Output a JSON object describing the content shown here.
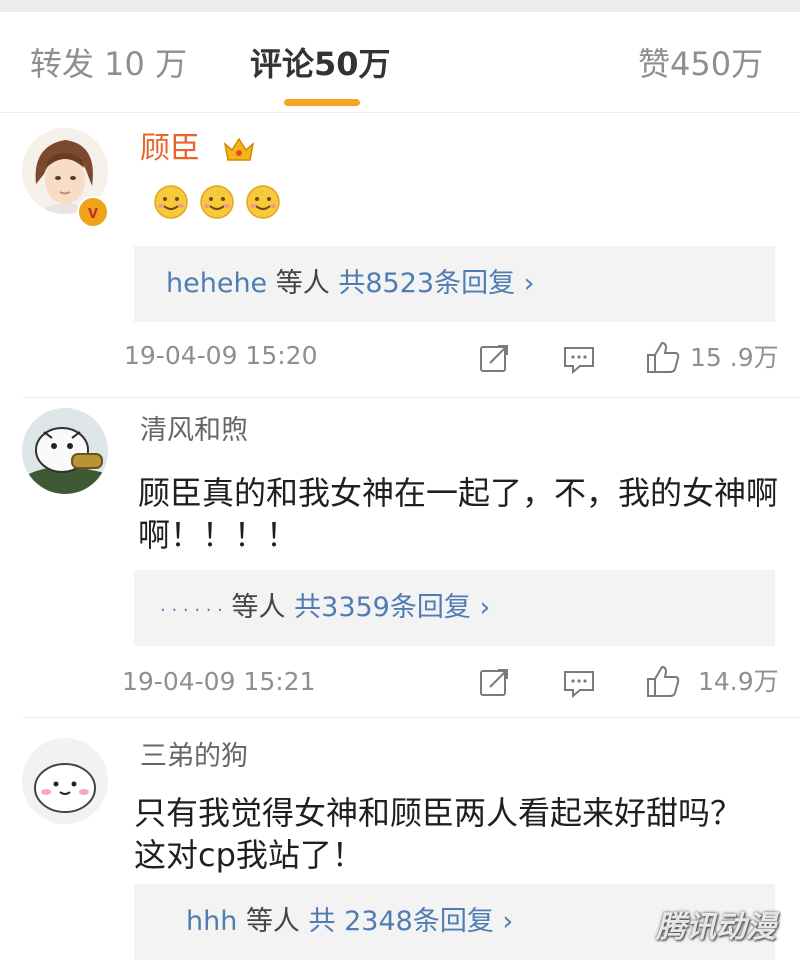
{
  "tabs": {
    "forward_label": "转发 10 万",
    "comments_label": "评论50万",
    "likes_label": "赞450万",
    "accent_color": "#f7a526"
  },
  "comments": [
    {
      "username": "顾臣",
      "username_color": "#e8652a",
      "badges": [
        "crown-icon",
        "verified-v-icon"
      ],
      "emojis": [
        "smile-emoji",
        "smile-emoji",
        "smile-emoji"
      ],
      "reply_users": "hehehe",
      "reply_sep": "等人",
      "reply_total": "共8523条回复",
      "reply_chevron": "›",
      "time": "19-04-09 15:20",
      "likes": "15 .9万"
    },
    {
      "username": "清风和煦",
      "username_color": "#666666",
      "text": "顾臣真的和我女神在一起了，不，我的女神啊啊！！！！",
      "reply_users": "· · · · · ·",
      "reply_sep": "等人",
      "reply_total": "共3359条回复",
      "reply_chevron": "›",
      "time": "19-04-09 15:21",
      "likes": "14.9万"
    },
    {
      "username": "三弟的狗",
      "username_color": "#666666",
      "text": "只有我觉得女神和顾臣两人看起来好甜吗？这对cp我站了！",
      "reply_users": "hhh",
      "reply_sep": "等人",
      "reply_total": "共 2348条回复",
      "reply_chevron": "›"
    }
  ],
  "watermark": "腾讯动漫"
}
